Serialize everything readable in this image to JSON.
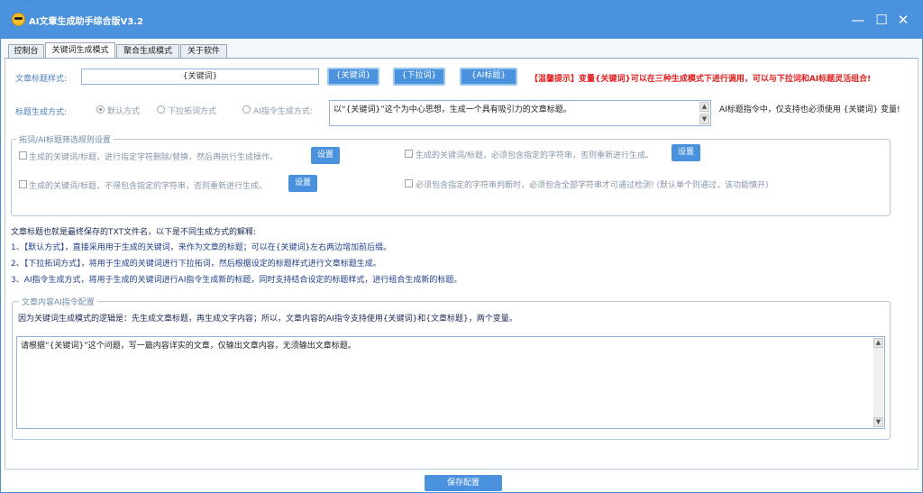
{
  "window": {
    "title": "AI文章生成助手综合版V3.2",
    "controls": {
      "minimize": "—",
      "maximize": "☐",
      "close": "✕"
    }
  },
  "tabs": [
    {
      "label": "控制台",
      "active": false
    },
    {
      "label": "关键词生成模式",
      "active": true
    },
    {
      "label": "聚合生成模式",
      "active": false
    },
    {
      "label": "关于软件",
      "active": false
    }
  ],
  "title_style": {
    "label": "文章标题样式:",
    "value": "{关键词}",
    "buttons": [
      "{关键词}",
      "{下拉词}",
      "{AI标题}"
    ],
    "tip": "【温馨提示】变量{关键词}可以在三种生成模式下进行调用，可以与下拉词和AI标题灵活组合!"
  },
  "title_gen": {
    "label": "标题生成方式:",
    "options": [
      {
        "label": "默认方式",
        "selected": true
      },
      {
        "label": "下拉拓词方式",
        "selected": false
      },
      {
        "label": "AI指令生成方式:",
        "selected": false
      }
    ],
    "ai_prompt": "以“{关键词}”这个为中心思想，生成一个具有吸引力的文章标题。",
    "ai_note": "AI标题指令中，仅支持也必须使用 {关键词} 变量!"
  },
  "filter_group": {
    "title": "拓词/AI标题筛选规则设置",
    "rules": [
      {
        "label": "生成的关键词/标题，进行指定字符删除/替换，然后再执行生成操作。",
        "checked": false,
        "button": "设置"
      },
      {
        "label": "生成的关键词/标题，必须包含指定的字符串，否则重新进行生成。",
        "checked": false,
        "button": "设置"
      },
      {
        "label": "生成的关键词/标题，不得包含指定的字符串，否则重新进行生成。",
        "checked": false,
        "button": "设置"
      },
      {
        "label": "必须包含指定的字符串判断时，必须包含全部字符串才可通过检测! (默认单个则通过，该功能慎开)",
        "checked": false,
        "button": ""
      }
    ]
  },
  "explanation": {
    "heading": "文章标题也就是最终保存的TXT文件名，以下是不同生成方式的解释:",
    "lines": [
      "1、【默认方式】，直接采用用于生成的关键词，来作为文章的标题；可以在{关键词}左右两边增加前后缀。",
      "2、【下拉拓词方式】，将用于生成的关键词进行下拉拓词，然后根据设定的标题样式进行文章标题生成。",
      "3、AI指令生成方式，将用于生成的关键词进行AI指令生成新的标题，同时支持结合设定的标题样式，进行组合生成新的标题。"
    ]
  },
  "content_group": {
    "title": "文章内容AI指令配置",
    "note": "因为关键词生成模式的逻辑是：先生成文章标题，再生成文字内容；所以，文章内容的AI指令支持使用{关键词}和{文章标题}，两个变量。",
    "prompt": "请根据“{关键词}”这个问题，写一篇内容详实的文章，仅输出文章内容，无须输出文章标题。"
  },
  "save_button": "保存配置",
  "colors": {
    "titlebar": "#4a92dd",
    "button": "#4a92dd",
    "tip_red": "#e02020",
    "desc_blue": "#1e3f8a",
    "label_blue": "#4a7fc0"
  }
}
